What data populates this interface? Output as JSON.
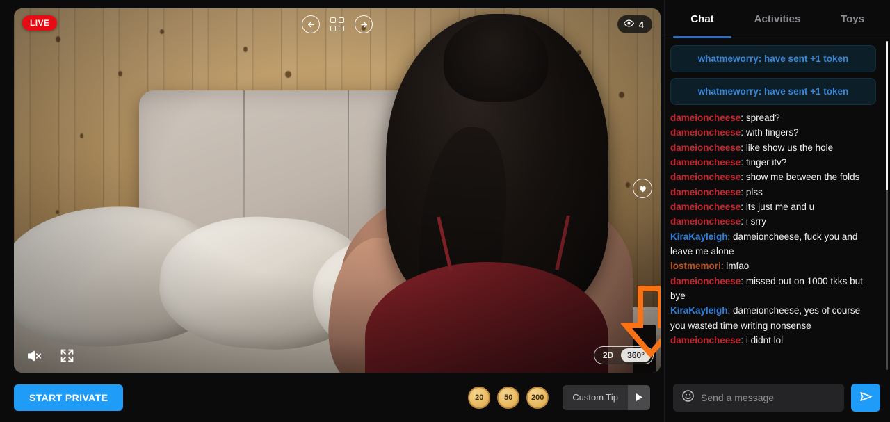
{
  "video": {
    "live_label": "LIVE",
    "viewers_count": "4",
    "viewers_icon": "eye-icon",
    "prev_icon": "arrow-left-circle-icon",
    "grid_icon": "grid-apps-icon",
    "next_icon": "arrow-right-circle-icon",
    "favorite_icon": "heart-circle-icon",
    "mute_icon": "speaker-muted-icon",
    "fullscreen_icon": "fullscreen-expand-icon",
    "mode_2d": "2D",
    "mode_360": "360°",
    "mode_selected": "360°",
    "annotation_icon": "orange-down-arrow-annotation",
    "annotation_color": "#F97316"
  },
  "actions": {
    "start_private_label": "START PRIVATE",
    "start_private_color": "#1F9CF7",
    "tip_coins": [
      "20",
      "50",
      "200"
    ],
    "custom_tip_label": "Custom Tip",
    "custom_tip_arrow_icon": "play-arrow-icon"
  },
  "chat": {
    "tabs": [
      {
        "label": "Chat",
        "active": true
      },
      {
        "label": "Activities",
        "active": false
      },
      {
        "label": "Toys",
        "active": false
      }
    ],
    "tip_notifications": [
      "whatmeworry: have sent +1 token",
      "whatmeworry: have sent +1 token"
    ],
    "messages": [
      {
        "user": "dameioncheese",
        "color": "red",
        "text": "spread?"
      },
      {
        "user": "dameioncheese",
        "color": "red",
        "text": "with fingers?"
      },
      {
        "user": "dameioncheese",
        "color": "red",
        "text": "like show us the hole"
      },
      {
        "user": "dameioncheese",
        "color": "red",
        "text": "finger itv?"
      },
      {
        "user": "dameioncheese",
        "color": "red",
        "text": "show me between the folds"
      },
      {
        "user": "dameioncheese",
        "color": "red",
        "text": "plss"
      },
      {
        "user": "dameioncheese",
        "color": "red",
        "text": "its just me and u"
      },
      {
        "user": "dameioncheese",
        "color": "red",
        "text": "i srry"
      },
      {
        "user": "KiraKayleigh",
        "color": "blue",
        "text": "dameioncheese, fuck you and leave me alone"
      },
      {
        "user": "lostmemori",
        "color": "orange",
        "text": "lmfao"
      },
      {
        "user": "dameioncheese",
        "color": "red",
        "text": "missed out on 1000 tkks but bye"
      },
      {
        "user": "KiraKayleigh",
        "color": "blue",
        "text": "dameioncheese, yes of course you wasted time writing nonsense"
      },
      {
        "user": "dameioncheese",
        "color": "red",
        "text": "i didnt lol"
      }
    ],
    "composer": {
      "emoji_icon": "smiley-face-icon",
      "placeholder": "Send a message",
      "value": "",
      "send_icon": "send-paper-plane-icon"
    }
  }
}
